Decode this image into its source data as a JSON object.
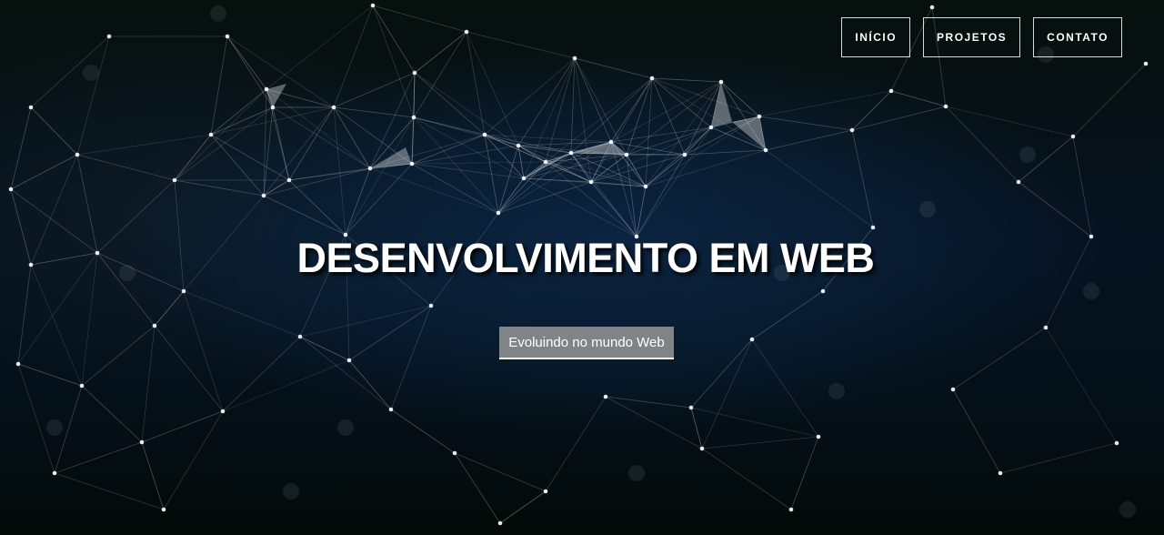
{
  "nav": {
    "items": [
      {
        "label": "INÍCIO"
      },
      {
        "label": "PROJETOS"
      },
      {
        "label": "CONTATO"
      }
    ]
  },
  "hero": {
    "title": "DESENVOLVIMENTO EM WEB",
    "tagline": "Evoluindo no mundo Web",
    "background": "network-plexus-image",
    "colors": {
      "background_dark": "#050a10",
      "background_blue": "#0b2440",
      "text": "#ffffff",
      "tagline_bg": "#969696"
    }
  }
}
